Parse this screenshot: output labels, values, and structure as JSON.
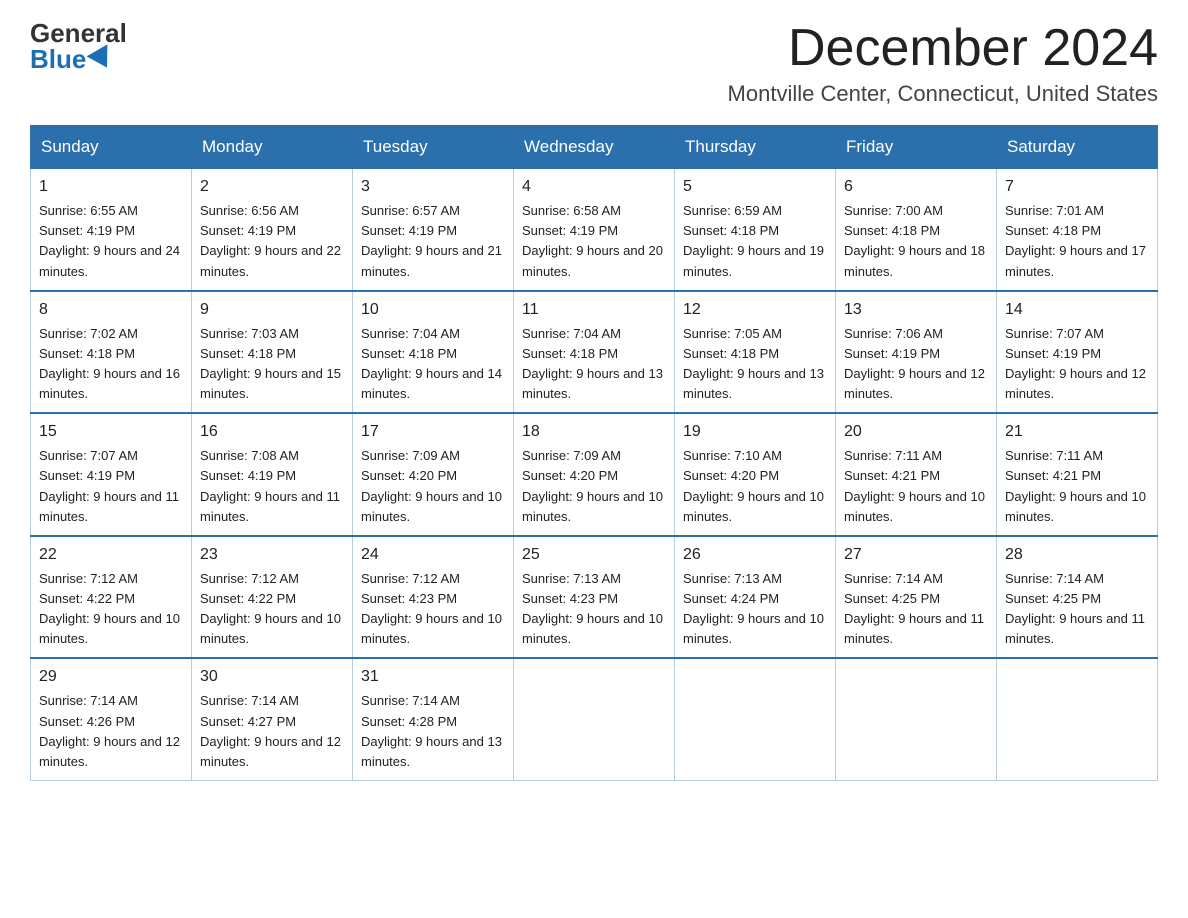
{
  "header": {
    "logo_general": "General",
    "logo_blue": "Blue",
    "month_title": "December 2024",
    "location": "Montville Center, Connecticut, United States"
  },
  "weekdays": [
    "Sunday",
    "Monday",
    "Tuesday",
    "Wednesday",
    "Thursday",
    "Friday",
    "Saturday"
  ],
  "weeks": [
    [
      {
        "day": "1",
        "sunrise": "6:55 AM",
        "sunset": "4:19 PM",
        "daylight": "9 hours and 24 minutes."
      },
      {
        "day": "2",
        "sunrise": "6:56 AM",
        "sunset": "4:19 PM",
        "daylight": "9 hours and 22 minutes."
      },
      {
        "day": "3",
        "sunrise": "6:57 AM",
        "sunset": "4:19 PM",
        "daylight": "9 hours and 21 minutes."
      },
      {
        "day": "4",
        "sunrise": "6:58 AM",
        "sunset": "4:19 PM",
        "daylight": "9 hours and 20 minutes."
      },
      {
        "day": "5",
        "sunrise": "6:59 AM",
        "sunset": "4:18 PM",
        "daylight": "9 hours and 19 minutes."
      },
      {
        "day": "6",
        "sunrise": "7:00 AM",
        "sunset": "4:18 PM",
        "daylight": "9 hours and 18 minutes."
      },
      {
        "day": "7",
        "sunrise": "7:01 AM",
        "sunset": "4:18 PM",
        "daylight": "9 hours and 17 minutes."
      }
    ],
    [
      {
        "day": "8",
        "sunrise": "7:02 AM",
        "sunset": "4:18 PM",
        "daylight": "9 hours and 16 minutes."
      },
      {
        "day": "9",
        "sunrise": "7:03 AM",
        "sunset": "4:18 PM",
        "daylight": "9 hours and 15 minutes."
      },
      {
        "day": "10",
        "sunrise": "7:04 AM",
        "sunset": "4:18 PM",
        "daylight": "9 hours and 14 minutes."
      },
      {
        "day": "11",
        "sunrise": "7:04 AM",
        "sunset": "4:18 PM",
        "daylight": "9 hours and 13 minutes."
      },
      {
        "day": "12",
        "sunrise": "7:05 AM",
        "sunset": "4:18 PM",
        "daylight": "9 hours and 13 minutes."
      },
      {
        "day": "13",
        "sunrise": "7:06 AM",
        "sunset": "4:19 PM",
        "daylight": "9 hours and 12 minutes."
      },
      {
        "day": "14",
        "sunrise": "7:07 AM",
        "sunset": "4:19 PM",
        "daylight": "9 hours and 12 minutes."
      }
    ],
    [
      {
        "day": "15",
        "sunrise": "7:07 AM",
        "sunset": "4:19 PM",
        "daylight": "9 hours and 11 minutes."
      },
      {
        "day": "16",
        "sunrise": "7:08 AM",
        "sunset": "4:19 PM",
        "daylight": "9 hours and 11 minutes."
      },
      {
        "day": "17",
        "sunrise": "7:09 AM",
        "sunset": "4:20 PM",
        "daylight": "9 hours and 10 minutes."
      },
      {
        "day": "18",
        "sunrise": "7:09 AM",
        "sunset": "4:20 PM",
        "daylight": "9 hours and 10 minutes."
      },
      {
        "day": "19",
        "sunrise": "7:10 AM",
        "sunset": "4:20 PM",
        "daylight": "9 hours and 10 minutes."
      },
      {
        "day": "20",
        "sunrise": "7:11 AM",
        "sunset": "4:21 PM",
        "daylight": "9 hours and 10 minutes."
      },
      {
        "day": "21",
        "sunrise": "7:11 AM",
        "sunset": "4:21 PM",
        "daylight": "9 hours and 10 minutes."
      }
    ],
    [
      {
        "day": "22",
        "sunrise": "7:12 AM",
        "sunset": "4:22 PM",
        "daylight": "9 hours and 10 minutes."
      },
      {
        "day": "23",
        "sunrise": "7:12 AM",
        "sunset": "4:22 PM",
        "daylight": "9 hours and 10 minutes."
      },
      {
        "day": "24",
        "sunrise": "7:12 AM",
        "sunset": "4:23 PM",
        "daylight": "9 hours and 10 minutes."
      },
      {
        "day": "25",
        "sunrise": "7:13 AM",
        "sunset": "4:23 PM",
        "daylight": "9 hours and 10 minutes."
      },
      {
        "day": "26",
        "sunrise": "7:13 AM",
        "sunset": "4:24 PM",
        "daylight": "9 hours and 10 minutes."
      },
      {
        "day": "27",
        "sunrise": "7:14 AM",
        "sunset": "4:25 PM",
        "daylight": "9 hours and 11 minutes."
      },
      {
        "day": "28",
        "sunrise": "7:14 AM",
        "sunset": "4:25 PM",
        "daylight": "9 hours and 11 minutes."
      }
    ],
    [
      {
        "day": "29",
        "sunrise": "7:14 AM",
        "sunset": "4:26 PM",
        "daylight": "9 hours and 12 minutes."
      },
      {
        "day": "30",
        "sunrise": "7:14 AM",
        "sunset": "4:27 PM",
        "daylight": "9 hours and 12 minutes."
      },
      {
        "day": "31",
        "sunrise": "7:14 AM",
        "sunset": "4:28 PM",
        "daylight": "9 hours and 13 minutes."
      },
      null,
      null,
      null,
      null
    ]
  ]
}
